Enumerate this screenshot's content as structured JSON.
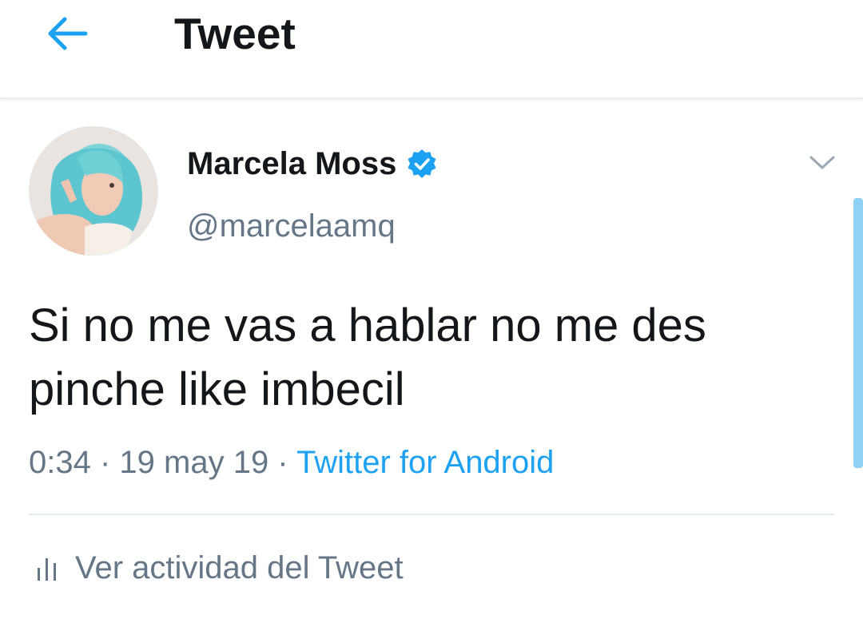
{
  "header": {
    "title": "Tweet",
    "back_icon": "arrow-left-icon"
  },
  "tweet": {
    "author_name": "Marcela Moss",
    "verified_icon": "verified-badge-icon",
    "handle": "@marcelaamq",
    "text": "Si no me vas a hablar no me des pinche like imbecil",
    "time": "0:34",
    "separator_1": " · ",
    "date": "19 may 19",
    "separator_2": " · ",
    "source": "Twitter for Android",
    "menu_icon": "chevron-down-icon"
  },
  "activity": {
    "label": "Ver actividad del Tweet",
    "icon": "bar-chart-icon"
  },
  "colors": {
    "accent": "#1da1f2",
    "text_primary": "#14171a",
    "text_secondary": "#657786",
    "divider": "#e6ecf0"
  }
}
